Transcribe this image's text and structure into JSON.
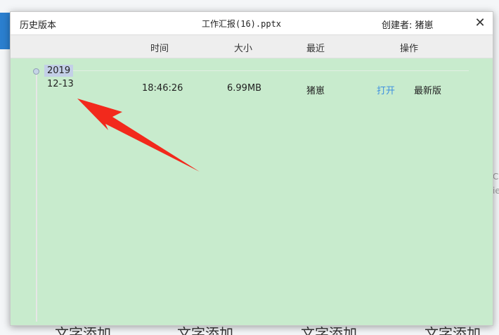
{
  "background": {
    "right_fragments": [
      "C",
      "ie"
    ],
    "bottom_labels": [
      "文字添加",
      "文字添加",
      "文字添加",
      "文字添加"
    ]
  },
  "dialog": {
    "title": "历史版本",
    "file_name": "工作汇报(16).pptx",
    "creator_label": "创建者: 猪崽",
    "close_glyph": "✕",
    "columns": {
      "time": "时间",
      "size": "大小",
      "recent": "最近",
      "action": "操作"
    },
    "versions": [
      {
        "year": "2019",
        "date": "12-13",
        "time": "18:46:26",
        "size": "6.99MB",
        "recent_user": "猪崽",
        "open_label": "打开",
        "status": "最新版"
      }
    ]
  },
  "colors": {
    "content_bg": "#c8ebcd",
    "link": "#3d8fe0",
    "arrow": "#f2291c",
    "year_tag": "#c3cfe7"
  },
  "icons": {
    "close": "close-icon",
    "annotation": "red-arrow-icon",
    "timeline_node": "timeline-dot-icon"
  }
}
